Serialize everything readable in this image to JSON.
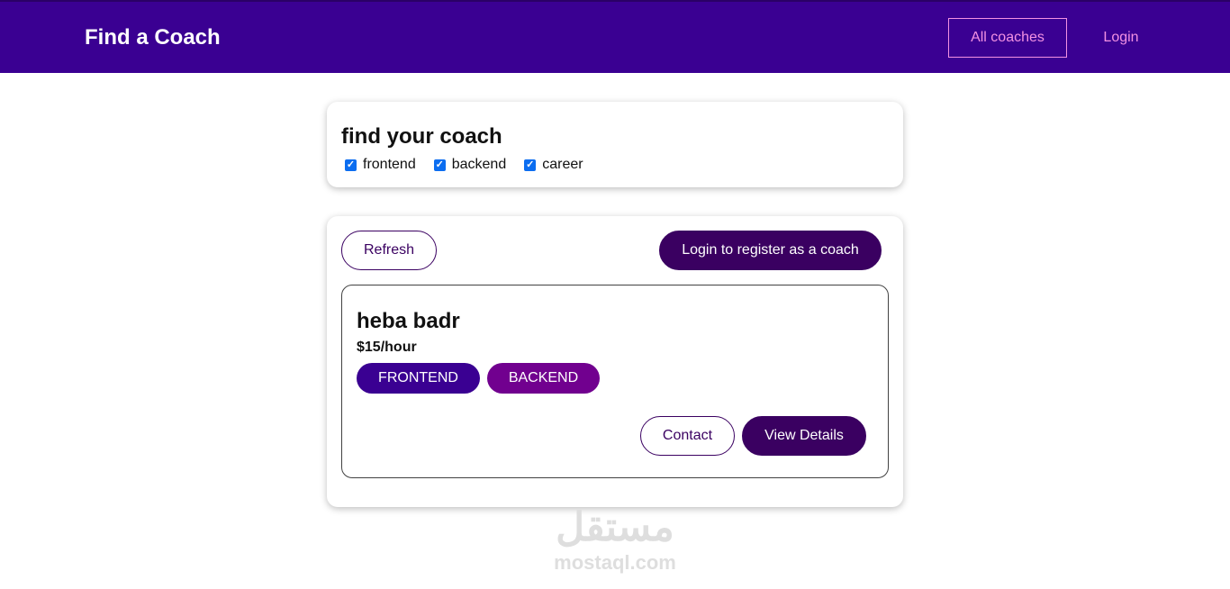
{
  "header": {
    "brand": "Find a Coach",
    "nav": {
      "all_coaches": "All coaches",
      "login": "Login"
    }
  },
  "filter": {
    "title": "find your coach",
    "options": [
      {
        "label": "frontend",
        "checked": true
      },
      {
        "label": "backend",
        "checked": true
      },
      {
        "label": "career",
        "checked": true
      }
    ]
  },
  "list": {
    "refresh_label": "Refresh",
    "register_label": "Login to register as a coach",
    "coaches": [
      {
        "name": "heba badr",
        "rate": "$15/hour",
        "areas": [
          "FRONTEND",
          "BACKEND"
        ],
        "contact_label": "Contact",
        "details_label": "View Details"
      }
    ]
  },
  "watermark": {
    "logo": "مستقل",
    "url": "mostaql.com"
  },
  "colors": {
    "header_bg": "#3a0092",
    "nav_accent": "#f391e3",
    "primary": "#3a0061",
    "frontend_badge": "#3a0092",
    "backend_badge": "#71008f",
    "checkbox": "#0b6df0"
  }
}
